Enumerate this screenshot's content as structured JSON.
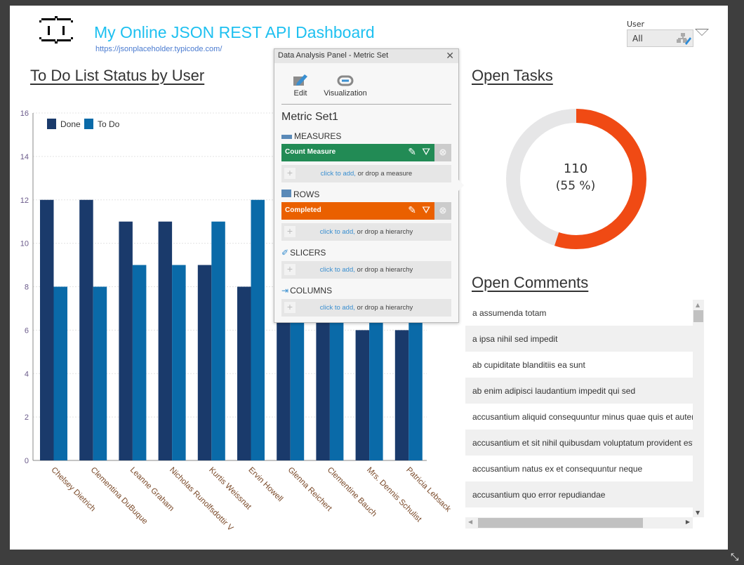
{
  "header": {
    "title": "My Online JSON REST API Dashboard",
    "url": "https://jsonplaceholder.typicode.com/",
    "logo": "brackets-logo"
  },
  "filter": {
    "label": "User",
    "value": "All",
    "icon": "hierarchy-edit-icon"
  },
  "todo_chart": {
    "heading": "To Do List Status by User"
  },
  "chart_data": {
    "type": "bar",
    "categories": [
      "Chelsey Dietrich",
      "Clementina DuBuque",
      "Leanne Graham",
      "Nicholas Runolfsdottir V",
      "Kurtis Weissnat",
      "Ervin Howell",
      "Glenna Reichert",
      "Clementine Bauch",
      "Mrs. Dennis Schulist",
      "Patricia Lebsack"
    ],
    "series": [
      {
        "name": "Done",
        "color": "#1a3a6b",
        "values": [
          12,
          12,
          11,
          11,
          9,
          8,
          8,
          7,
          6,
          6
        ]
      },
      {
        "name": "To Do",
        "color": "#0a6aa8",
        "values": [
          8,
          8,
          9,
          9,
          11,
          12,
          12,
          13,
          14,
          14
        ]
      }
    ],
    "ylim": [
      0,
      16
    ],
    "yticks": [
      0,
      2,
      4,
      6,
      8,
      10,
      12,
      14,
      16
    ],
    "grid": true,
    "legend": "top-left"
  },
  "panel": {
    "title": "Data Analysis Panel - Metric Set",
    "edit_label": "Edit",
    "viz_label": "Visualization",
    "metric_set": "Metric Set1",
    "measures": {
      "label": "MEASURES",
      "item": "Count Measure",
      "color": "#228b55",
      "add_link": "click to add,",
      "add_rest": " or drop a measure"
    },
    "rows": {
      "label": "ROWS",
      "item": "Completed",
      "color": "#ea6000",
      "add_link": "click to add,",
      "add_rest": " or drop a hierarchy"
    },
    "slicers": {
      "label": "SLICERS",
      "add_link": "click to add,",
      "add_rest": " or drop a hierarchy"
    },
    "columns": {
      "label": "COLUMNS",
      "add_link": "click to add,",
      "add_rest": " or drop a hierarchy"
    }
  },
  "open_tasks": {
    "heading": "Open Tasks",
    "value": "110",
    "percent_label": "(55 %)",
    "fraction": 0.55,
    "color": "#f04a14"
  },
  "open_comments": {
    "heading": "Open Comments",
    "items": [
      "a assumenda totam",
      "a ipsa nihil sed impedit",
      "ab cupiditate blanditiis ea sunt",
      "ab enim adipisci laudantium impedit qui sed",
      "accusantium aliquid consequuntur minus quae quis et autem",
      "accusantium et sit nihil quibusdam voluptatum provident est",
      "accusantium natus ex et consequuntur neque",
      "accusantium quo error repudiandae"
    ]
  }
}
